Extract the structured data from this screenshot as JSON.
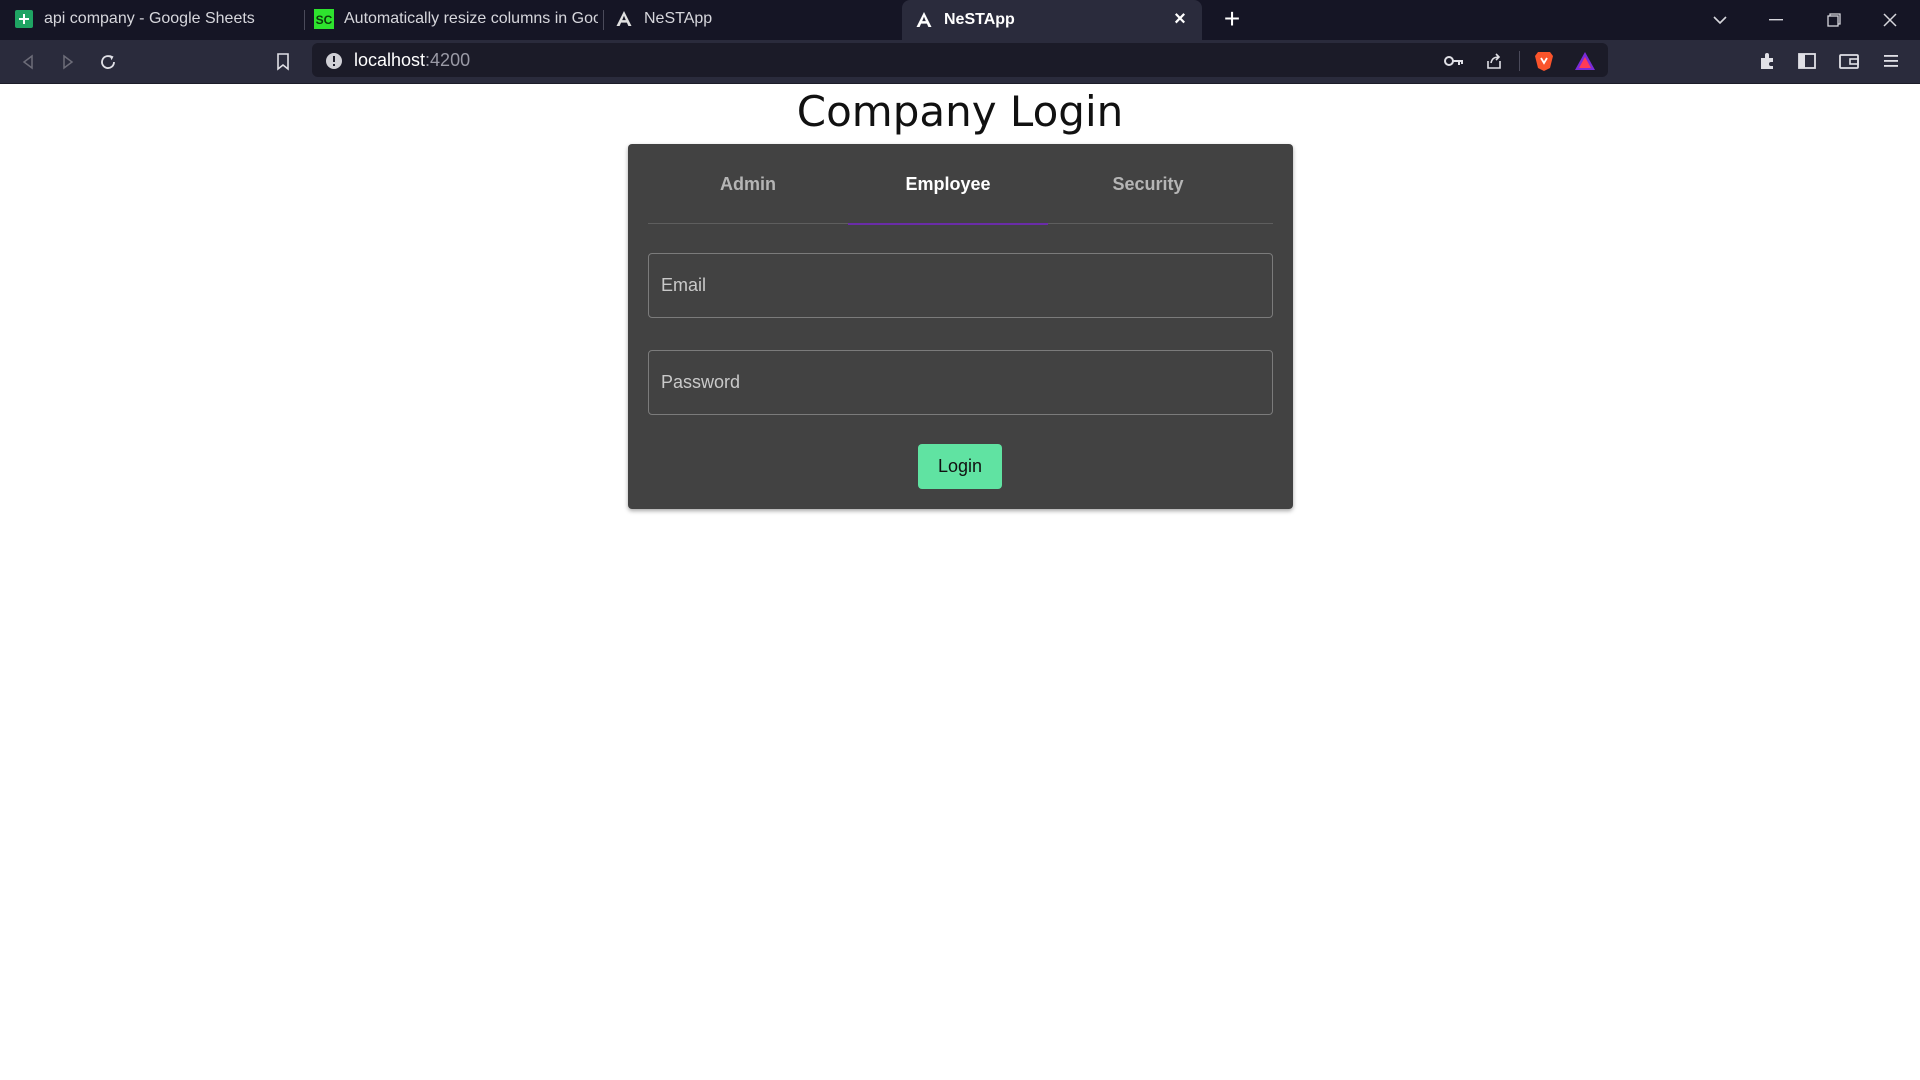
{
  "browser": {
    "tabs": [
      {
        "title": "api company - Google Sheets",
        "icon": "google-sheets-icon"
      },
      {
        "title": "Automatically resize columns in Googl",
        "icon": "sc-favicon"
      },
      {
        "title": "NeSTApp",
        "icon": "angular-icon"
      },
      {
        "title": "NeSTApp",
        "icon": "angular-icon",
        "active": true
      }
    ],
    "address": {
      "host": "localhost",
      "port": ":4200"
    },
    "colors": {
      "tabstrip": "#151525",
      "toolbar": "#2a2b3c",
      "omnibox": "#1b1b28"
    }
  },
  "page": {
    "title": "Company Login",
    "tabs": [
      {
        "label": "Admin"
      },
      {
        "label": "Employee",
        "active": true
      },
      {
        "label": "Security"
      }
    ],
    "email": {
      "placeholder": "Email",
      "value": ""
    },
    "password": {
      "placeholder": "Password",
      "value": ""
    },
    "login_label": "Login",
    "colors": {
      "card": "#424242",
      "accent": "#6a2ca8",
      "button": "#60e3a2"
    }
  }
}
